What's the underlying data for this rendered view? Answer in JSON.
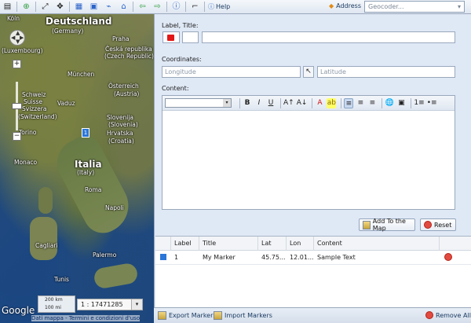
{
  "toolbar": {
    "help_label": "Help",
    "address_label": "Address",
    "geocoder_placeholder": "Geocoder...",
    "icons": [
      "layers-icon",
      "zoom-in-icon",
      "fit-map-icon",
      "pan-icon",
      "zoom-box-icon",
      "select-icon",
      "draw-line-icon",
      "draw-area-icon",
      "back-arrow-icon",
      "forward-arrow-icon",
      "info-icon",
      "tool-icon",
      "help-icon",
      "address-icon"
    ]
  },
  "map": {
    "labels": [
      "Köln",
      "Deutschland",
      "(Germany)",
      "Praha",
      "Česká republika",
      "(Czech Republic)",
      "München",
      "Österreich",
      "(Austria)",
      "Schweiz",
      "Suisse",
      "Svizzera",
      "(Switzerland)",
      "Slovenija",
      "(Slovenia)",
      "Hrvatska",
      "(Croatia)",
      "Torino",
      "Monaco",
      "Italia",
      "(Italy)",
      "Roma",
      "Napoli",
      "Palermo",
      "Tunis",
      "Cagliari",
      "Vaduz",
      "(Luxembourg)"
    ],
    "marker_label": "1",
    "scale_top": "200 km",
    "scale_bottom": "100 mi",
    "ratio": "1 : 17471285",
    "google": "Google",
    "links": "Dati mappa - Termini e condizioni d'uso"
  },
  "form": {
    "label_title": "Label, Title:",
    "coordinates_label": "Coordinates:",
    "longitude_placeholder": "Longitude",
    "latitude_placeholder": "Latitude",
    "content_label": "Content:",
    "add_button": "Add To the Map",
    "reset_button": "Reset"
  },
  "editor": {
    "tools": [
      "B",
      "I",
      "U",
      "A↑",
      "A↓",
      "A",
      "ab",
      "≡",
      "≡",
      "≡",
      "🌐",
      "▣",
      "1≡",
      "•≡"
    ]
  },
  "table": {
    "headers": [
      "Label",
      "Title",
      "Lat",
      "Lon",
      "Content"
    ],
    "rows": [
      {
        "label": "1",
        "title": "My Marker",
        "lat": "45.75...",
        "lon": "12.01...",
        "content": "Sample Text"
      }
    ]
  },
  "bottom": {
    "export": "Export Markers",
    "import": "Import Markers",
    "remove_all": "Remove All"
  },
  "colors": {
    "accent": "#2b76d8",
    "danger": "#e24b40",
    "panel": "#dfe8f5"
  }
}
